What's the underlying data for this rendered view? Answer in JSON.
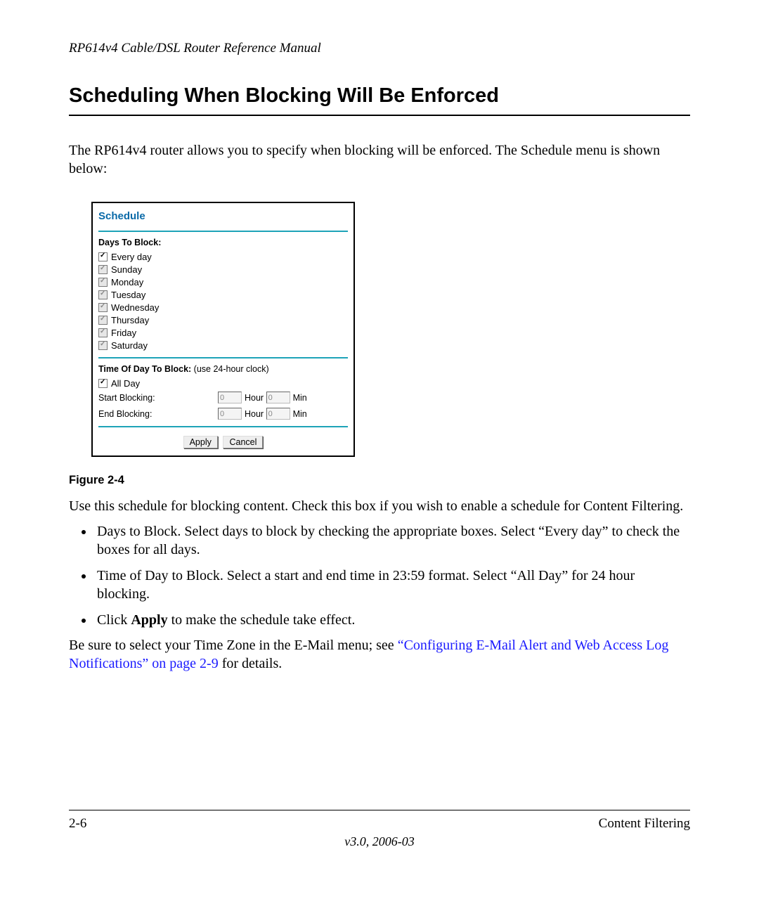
{
  "header": {
    "running": "RP614v4 Cable/DSL Router Reference Manual"
  },
  "section": {
    "title": "Scheduling When Blocking Will Be Enforced",
    "intro": "The RP614v4 router allows you to specify when blocking will be enforced. The Schedule menu is shown below:"
  },
  "figure": {
    "panel_title": "Schedule",
    "days_heading": "Days To Block:",
    "days": [
      {
        "label": "Every day",
        "disabled": false
      },
      {
        "label": "Sunday",
        "disabled": true
      },
      {
        "label": "Monday",
        "disabled": true
      },
      {
        "label": "Tuesday",
        "disabled": true
      },
      {
        "label": "Wednesday",
        "disabled": true
      },
      {
        "label": "Thursday",
        "disabled": true
      },
      {
        "label": "Friday",
        "disabled": true
      },
      {
        "label": "Saturday",
        "disabled": true
      }
    ],
    "time_heading_bold": "Time Of Day To Block:",
    "time_heading_note": " (use 24-hour clock)",
    "all_day_label": "All Day",
    "start_label": "Start Blocking:",
    "end_label": "End Blocking:",
    "hour_unit": "Hour",
    "min_unit": "Min",
    "start_hour": "0",
    "start_min": "0",
    "end_hour": "0",
    "end_min": "0",
    "apply_label": "Apply",
    "cancel_label": "Cancel",
    "caption": "Figure 2-4"
  },
  "description": {
    "lead": "Use this schedule for blocking content. Check this box if you wish to enable a schedule for Content Filtering.",
    "bullet1": "Days to Block. Select days to block by checking the appropriate boxes. Select “Every day” to check the boxes for all days.",
    "bullet2": "Time of Day to Block. Select a start and end time in 23:59 format. Select “All Day” for 24 hour blocking.",
    "bullet3_pre": "Click ",
    "bullet3_bold": "Apply",
    "bullet3_post": " to make the schedule take effect.",
    "tail_pre": "Be sure to select your Time Zone in the E-Mail menu; see ",
    "tail_link": "“Configuring E-Mail Alert and Web Access Log Notifications” on page 2-9",
    "tail_post": " for details."
  },
  "footer": {
    "page": "2-6",
    "chapter": "Content Filtering",
    "version": "v3.0, 2006-03"
  }
}
